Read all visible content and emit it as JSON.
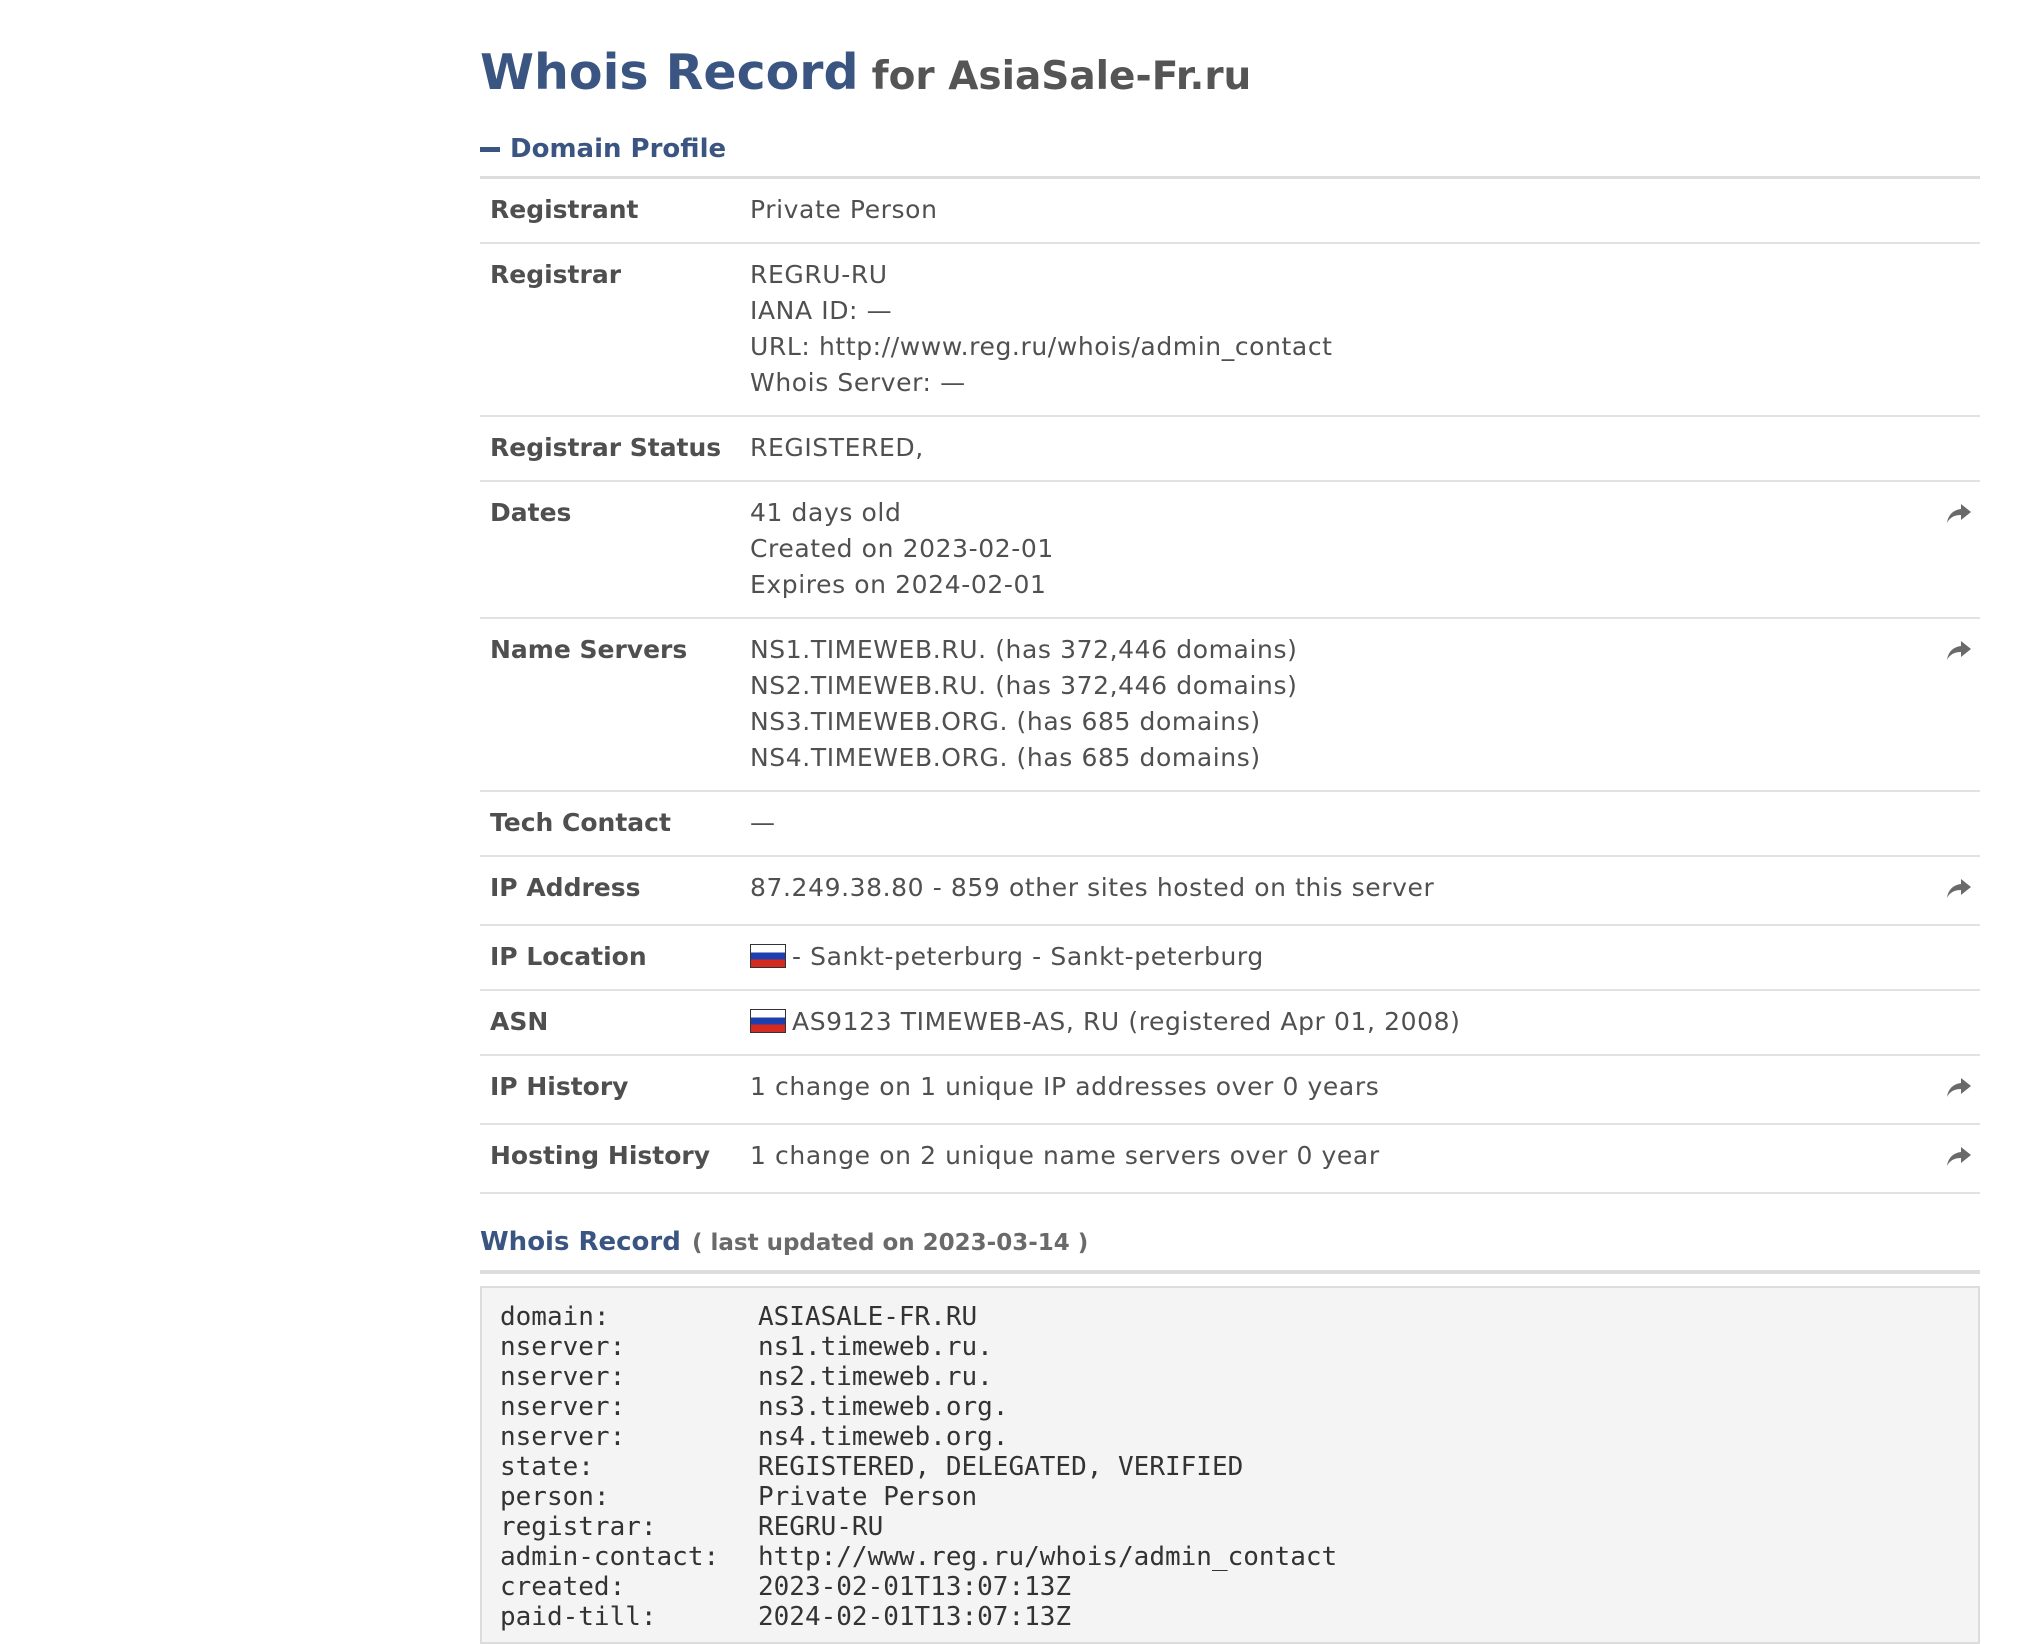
{
  "title": {
    "main": "Whois Record",
    "for": "for AsiaSale-Fr.ru"
  },
  "profile": {
    "heading": "Domain Profile",
    "rows": [
      {
        "label": "Registrant",
        "lines": [
          "Private Person"
        ],
        "share": false
      },
      {
        "label": "Registrar",
        "lines": [
          "REGRU-RU",
          "IANA ID: —",
          "URL: http://www.reg.ru/whois/admin_contact",
          "Whois Server: —"
        ],
        "share": false
      },
      {
        "label": "Registrar Status",
        "lines": [
          "REGISTERED,"
        ],
        "share": false
      },
      {
        "label": "Dates",
        "lines": [
          "41 days old",
          "Created on 2023-02-01",
          "Expires on 2024-02-01"
        ],
        "share": true
      },
      {
        "label": "Name Servers",
        "lines": [
          "NS1.TIMEWEB.RU. (has 372,446 domains)",
          "NS2.TIMEWEB.RU. (has 372,446 domains)",
          "NS3.TIMEWEB.ORG. (has 685 domains)",
          "NS4.TIMEWEB.ORG. (has 685 domains)"
        ],
        "share": true
      },
      {
        "label": "Tech Contact",
        "lines": [
          "—"
        ],
        "share": false
      },
      {
        "label": "IP Address",
        "lines": [
          "87.249.38.80 - 859 other sites hosted on this server"
        ],
        "share": true
      },
      {
        "label": "IP Location",
        "lines": [
          "- Sankt-peterburg - Sankt-peterburg"
        ],
        "share": false,
        "flag": true
      },
      {
        "label": "ASN",
        "lines": [
          "AS9123 TIMEWEB-AS, RU (registered Apr 01, 2008)"
        ],
        "share": false,
        "flag": true
      },
      {
        "label": "IP History",
        "lines": [
          "1 change on 1 unique IP addresses over 0 years"
        ],
        "share": true
      },
      {
        "label": "Hosting History",
        "lines": [
          "1 change on 2 unique name servers over 0 year"
        ],
        "share": true
      }
    ]
  },
  "record": {
    "title": "Whois Record",
    "subtitle": "( last updated on 2023-03-14 )",
    "lines": [
      {
        "key": "domain:",
        "value": "ASIASALE-FR.RU"
      },
      {
        "key": "nserver:",
        "value": "ns1.timeweb.ru."
      },
      {
        "key": "nserver:",
        "value": "ns2.timeweb.ru."
      },
      {
        "key": "nserver:",
        "value": "ns3.timeweb.org."
      },
      {
        "key": "nserver:",
        "value": "ns4.timeweb.org."
      },
      {
        "key": "state:",
        "value": "REGISTERED, DELEGATED, VERIFIED"
      },
      {
        "key": "person:",
        "value": "Private Person"
      },
      {
        "key": "registrar:",
        "value": "REGRU-RU"
      },
      {
        "key": "admin-contact:",
        "value": "http://www.reg.ru/whois/admin_contact"
      },
      {
        "key": "created:",
        "value": "2023-02-01T13:07:13Z"
      },
      {
        "key": "paid-till:",
        "value": "2024-02-01T13:07:13Z"
      }
    ]
  },
  "icons": {
    "share": "share-arrow-icon",
    "collapse": "minus-icon",
    "flag": "russia-flag-icon"
  },
  "colors": {
    "accent": "#3b5582",
    "divider": "#e2e2e2",
    "code_bg": "#f4f4f4"
  }
}
